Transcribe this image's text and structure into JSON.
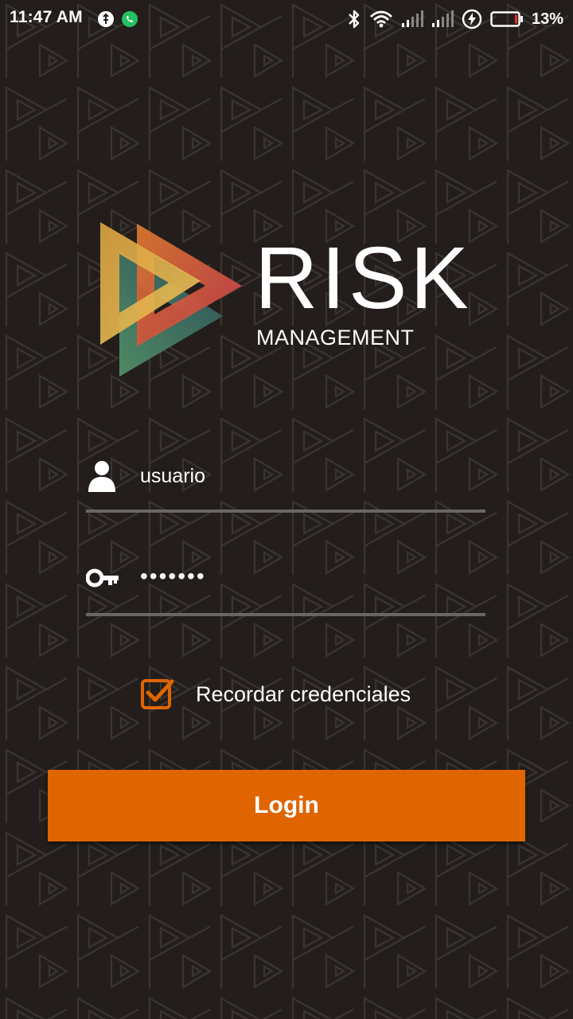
{
  "status_bar": {
    "time": "11:47 AM",
    "battery_percent": "13%",
    "left_icons": [
      "usb-debug-icon",
      "whatsapp-icon"
    ],
    "right_icons": [
      "bluetooth-icon",
      "wifi-icon",
      "signal-icon",
      "signal-icon",
      "charging-icon",
      "battery-icon"
    ]
  },
  "logo": {
    "word": "RISK",
    "subtitle": "MANAGEMENT",
    "colors": {
      "yellow": "#e2b34a",
      "red": "#c9474a",
      "teal": "#3d6a63",
      "orange": "#d8782e"
    }
  },
  "form": {
    "username_value": "usuario",
    "password_value": "•••••••",
    "remember_label": "Recordar credenciales",
    "remember_checked": true,
    "login_label": "Login"
  },
  "colors": {
    "background": "#231e1c",
    "accent": "#e06500",
    "underline": "#6a6664"
  }
}
